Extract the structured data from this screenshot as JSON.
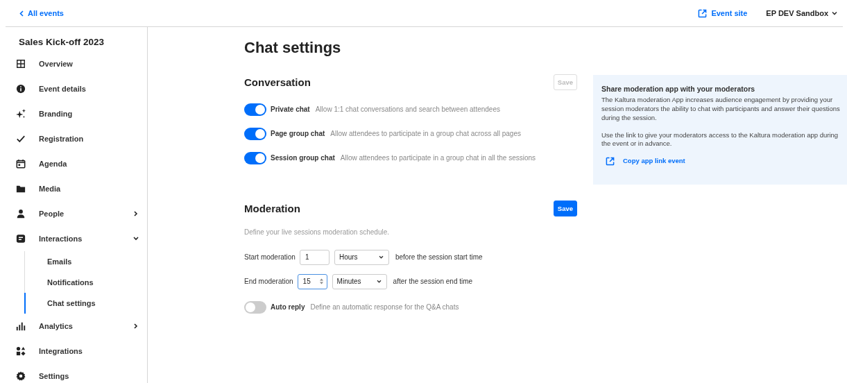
{
  "top_bar": {
    "back_link": "All events",
    "event_site_link": "Event site",
    "account_menu": "EP DEV Sandbox"
  },
  "sidebar": {
    "title": "Sales Kick-off 2023",
    "items": [
      {
        "label": "Overview",
        "kind": "link",
        "selected": false
      },
      {
        "label": "Event details",
        "kind": "link",
        "selected": false
      },
      {
        "label": "Branding",
        "kind": "link",
        "selected": false
      },
      {
        "label": "Registration",
        "kind": "link",
        "selected": false
      },
      {
        "label": "Agenda",
        "kind": "link",
        "selected": false
      },
      {
        "label": "Media",
        "kind": "link",
        "selected": false
      },
      {
        "label": "People",
        "kind": "group",
        "expanded": false,
        "selected": false
      },
      {
        "label": "Interactions",
        "kind": "group",
        "expanded": true,
        "selected": false,
        "children": [
          {
            "label": "Emails",
            "selected": false
          },
          {
            "label": "Notifications",
            "selected": false
          },
          {
            "label": "Chat settings",
            "selected": true
          }
        ]
      },
      {
        "label": "Analytics",
        "kind": "group",
        "expanded": false,
        "selected": false
      },
      {
        "label": "Integrations",
        "kind": "link",
        "selected": false
      },
      {
        "label": "Settings",
        "kind": "link",
        "selected": false
      }
    ]
  },
  "page_title": "Chat settings",
  "conversation": {
    "title": "Conversation",
    "save_button": {
      "label": "Save",
      "disabled": true
    },
    "toggles": [
      {
        "label": "Private chat",
        "description": "Allow 1:1 chat conversations and search between attendees",
        "on": true
      },
      {
        "label": "Page group chat",
        "description": "Allow attendees to participate in a group chat across all pages",
        "on": true
      },
      {
        "label": "Session group chat",
        "description": "Allow attendees to participate in a group chat in all the sessions",
        "on": true
      }
    ]
  },
  "moderation": {
    "title": "Moderation",
    "save_button": {
      "label": "Save",
      "disabled": false
    },
    "description": "Define your live sessions moderation schedule.",
    "rows": [
      {
        "label": "Start moderation",
        "amount": "1",
        "focused": false,
        "unit": "Hours",
        "suffix": "before the session start time"
      },
      {
        "label": "End moderation",
        "amount": "15",
        "focused": true,
        "unit": "Minutes",
        "suffix": "after the session end time"
      }
    ],
    "auto_reply": {
      "label": "Auto reply",
      "description": "Define an automatic response for the Q&A chats",
      "on": false
    }
  },
  "share_panel": {
    "title": "Share moderation app with your moderators",
    "paragraphs": [
      "The Kaltura moderation App increases audience engagement by providing your session moderators the ability to chat with participants and answer their questions during the session.",
      "Use the link to give your moderators access to the Kaltura moderation app during the event or in advance."
    ],
    "link": "Copy app link event"
  }
}
